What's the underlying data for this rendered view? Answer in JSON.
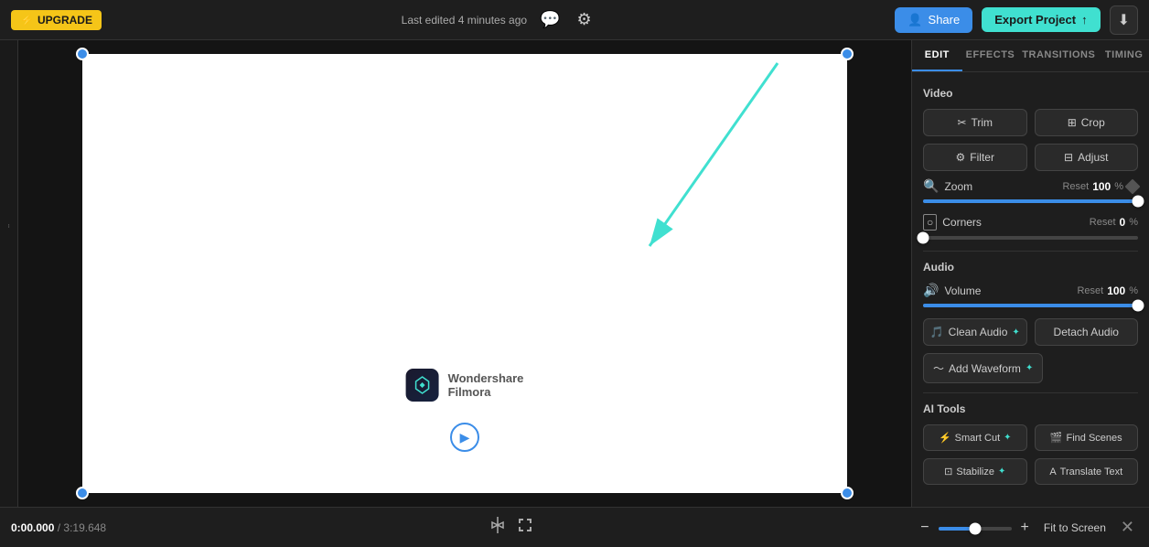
{
  "topbar": {
    "upgrade_label": "UPGRADE",
    "upgrade_icon": "⚡",
    "last_edited": "Last edited 4 minutes ago",
    "share_label": "Share",
    "export_label": "Export Project",
    "chat_icon": "💬",
    "settings_icon": "⚙"
  },
  "tabs": [
    {
      "id": "edit",
      "label": "EDIT",
      "active": true
    },
    {
      "id": "effects",
      "label": "EFFECTS",
      "active": false
    },
    {
      "id": "transitions",
      "label": "TRANSITIONS",
      "active": false
    },
    {
      "id": "timing",
      "label": "TIMING",
      "active": false
    }
  ],
  "panel": {
    "video_section": "Video",
    "trim_label": "Trim",
    "crop_label": "Crop",
    "filter_label": "Filter",
    "adjust_label": "Adjust",
    "zoom_label": "Zoom",
    "zoom_reset": "Reset",
    "zoom_value": "100",
    "zoom_unit": "%",
    "zoom_percent": 100,
    "corners_label": "Corners",
    "corners_reset": "Reset",
    "corners_value": "0",
    "corners_unit": "%",
    "corners_percent": 0,
    "audio_section": "Audio",
    "volume_label": "Volume",
    "volume_reset": "Reset",
    "volume_value": "100",
    "volume_unit": "%",
    "volume_percent": 100,
    "clean_audio_label": "Clean Audio",
    "detach_audio_label": "Detach Audio",
    "add_waveform_label": "Add Waveform",
    "ai_tools_section": "AI Tools",
    "smart_cut_label": "Smart Cut",
    "find_scenes_label": "Find Scenes",
    "stabilize_label": "Stabilize",
    "translate_text_label": "Translate Text"
  },
  "bottombar": {
    "time_current": "0:00.000",
    "time_separator": " / ",
    "time_total": "3:19.648",
    "fit_to_screen": "Fit to Screen",
    "zoom_minus": "−",
    "zoom_plus": "+"
  },
  "canvas": {
    "watermark_text": "Wondershare\nFilmora"
  }
}
